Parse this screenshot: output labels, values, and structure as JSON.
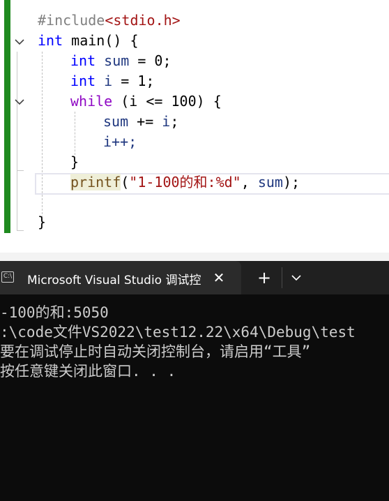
{
  "editor": {
    "lines": {
      "l1": {
        "pp": "#include",
        "hdr": "<stdio.h>"
      },
      "l2": {
        "kw": "int",
        "rest": " main() {"
      },
      "l3": {
        "kw": "int",
        "var": " sum",
        "rest": " = 0;"
      },
      "l4": {
        "kw": "int",
        "var": " i",
        "rest": " = 1;"
      },
      "l5": {
        "kw": "while",
        "rest": " (i <= 100) {"
      },
      "l6": {
        "var": "sum",
        "op": " += ",
        "var2": "i",
        "rest": ";"
      },
      "l7": {
        "text": "i++;"
      },
      "l8": {
        "text": "}"
      },
      "l9": {
        "fn": "printf",
        "open": "(",
        "str": "\"1-100的和:%d\"",
        "mid": ", ",
        "var": "sum",
        "close": ");"
      },
      "l10": {
        "text": "}"
      }
    },
    "accent_color": "#1f8a1f"
  },
  "console": {
    "tab_title": "Microsoft Visual Studio 调试控",
    "tab_icon": "terminal-icon",
    "close_glyph": "✕",
    "new_tab_glyph": "+",
    "output": [
      "-100的和:5050",
      ":\\code文件VS2022\\test12.22\\x64\\Debug\\test",
      "要在调试停止时自动关闭控制台，请启用“工具”",
      "按任意键关闭此窗口. . ."
    ]
  }
}
